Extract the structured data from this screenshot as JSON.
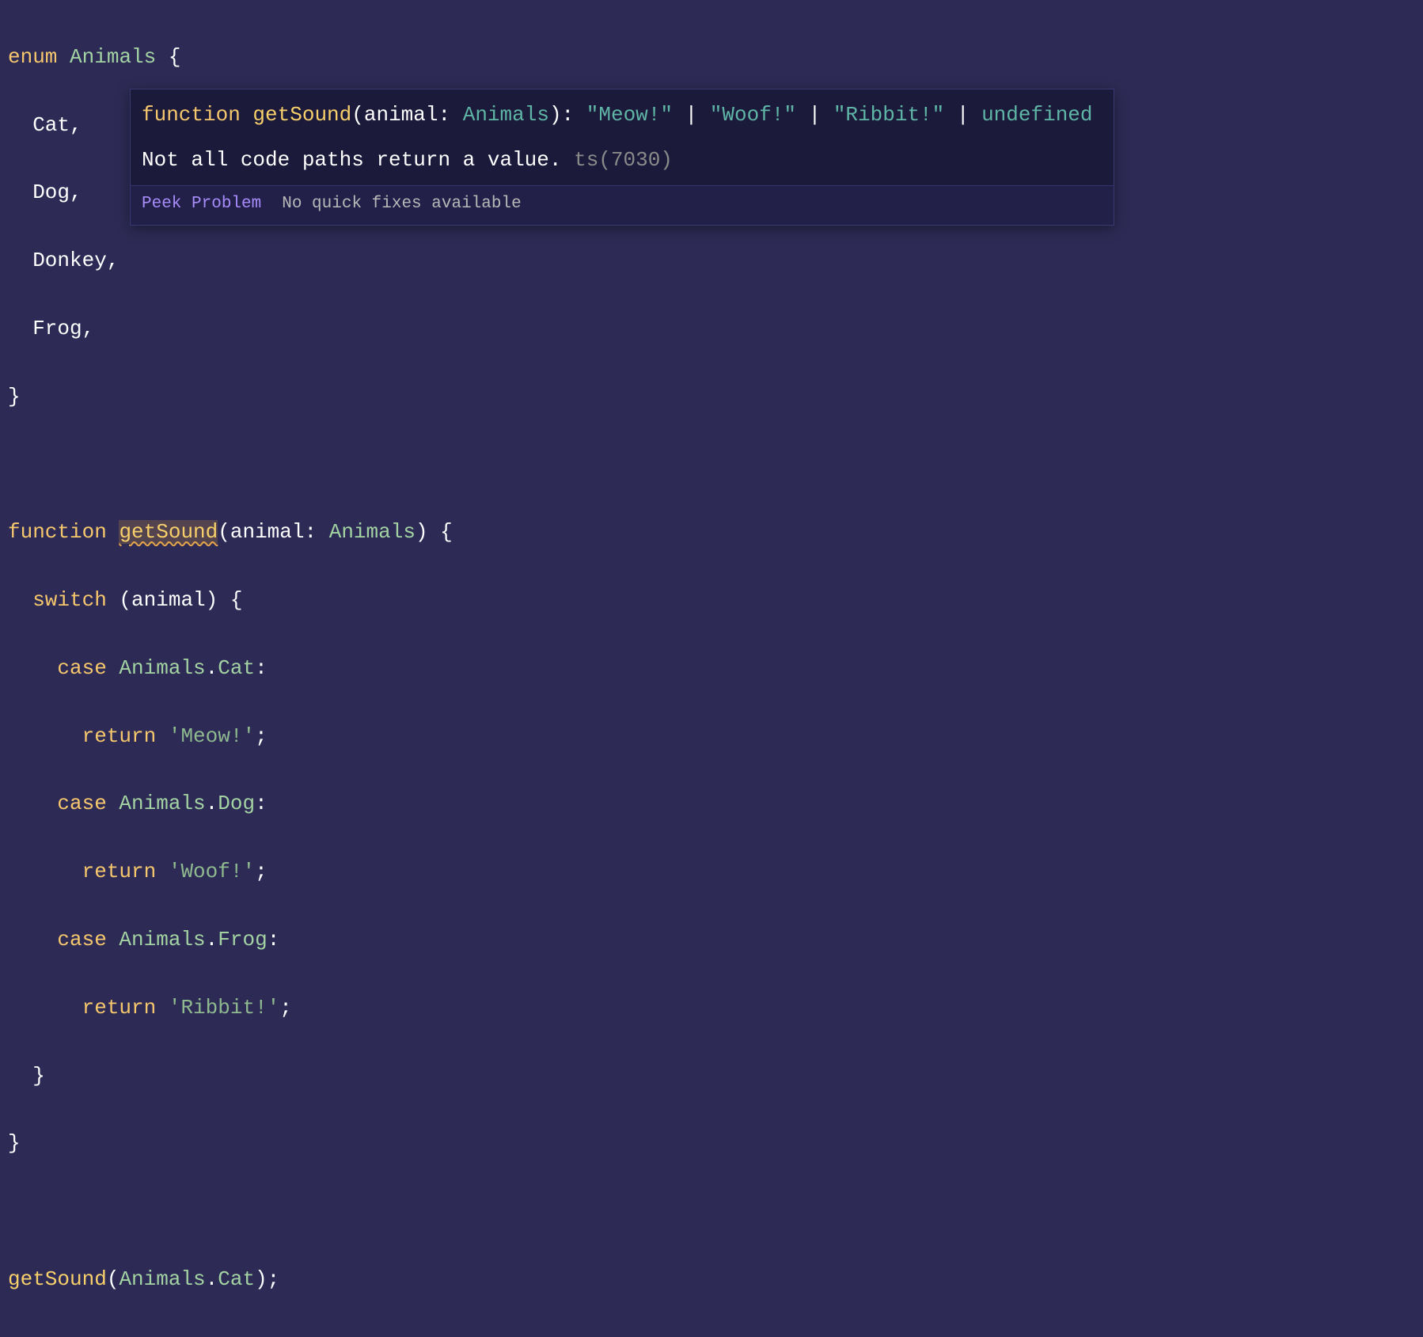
{
  "code": {
    "l1_enum": "enum",
    "l1_name": "Animals",
    "l1_brace": " {",
    "l2": "  Cat,",
    "l3": "  Dog,",
    "l4": "  Donkey,",
    "l5": "  Frog,",
    "l6": "}",
    "l8_fn": "function",
    "l8_name": "getSound",
    "l8_open": "(",
    "l8_param": "animal",
    "l8_colon": ": ",
    "l8_type": "Animals",
    "l8_close": ") {",
    "l9_switch": "  switch",
    "l9_open": " (",
    "l9_var": "animal",
    "l9_close": ") {",
    "l10_case": "    case",
    "l10_obj": " Animals",
    "l10_dot": ".",
    "l10_mem": "Cat",
    "l10_colon": ":",
    "l11_ret": "      return",
    "l11_str": " 'Meow!'",
    "l11_semi": ";",
    "l12_case": "    case",
    "l12_obj": " Animals",
    "l12_dot": ".",
    "l12_mem": "Dog",
    "l12_colon": ":",
    "l13_ret": "      return",
    "l13_str": " 'Woof!'",
    "l13_semi": ";",
    "l14_case": "    case",
    "l14_obj": " Animals",
    "l14_dot": ".",
    "l14_mem": "Frog",
    "l14_colon": ":",
    "l15_ret": "      return",
    "l15_str": " 'Ribbit!'",
    "l15_semi": ";",
    "l16": "  }",
    "l17": "}",
    "l19_call": "getSound",
    "l19_open": "(",
    "l19_obj": "Animals",
    "l19_dot": ".",
    "l19_mem": "Cat",
    "l19_close": ");"
  },
  "hover": {
    "sig_kw": "function",
    "sig_name": " getSound",
    "sig_open": "(",
    "sig_param": "animal",
    "sig_colon": ": ",
    "sig_type": "Animals",
    "sig_close": ")",
    "sig_ret_colon": ": ",
    "sig_ret1": "\"Meow!\"",
    "sig_pipe1": " | ",
    "sig_ret2": "\"Woof!\"",
    "sig_pipe2": " | ",
    "sig_ret3": "\"Ribbit!\"",
    "sig_pipe3": " | ",
    "sig_ret4": "undefined",
    "error_msg": "Not all code paths return a value. ",
    "error_code": "ts(7030)",
    "action_peek": "Peek Problem",
    "action_nofix": "No quick fixes available"
  }
}
